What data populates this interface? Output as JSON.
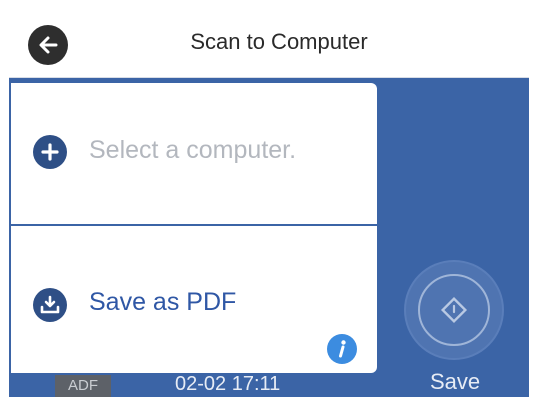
{
  "header": {
    "title": "Scan to Computer",
    "back_icon": "arrow-left-icon"
  },
  "options": [
    {
      "label": "Select a computer.",
      "icon": "plus-circle-icon",
      "state": "placeholder"
    },
    {
      "label": "Save as PDF",
      "icon": "download-tray-icon",
      "state": "selected"
    }
  ],
  "info_icon": "info-icon",
  "start_button": {
    "label": "Save",
    "icon": "diamond-start-icon"
  },
  "status_bar": {
    "source": "ADF",
    "datetime": "02-02 17:11"
  },
  "colors": {
    "screen_background": "#3b64a6",
    "accent_text": "#2f57a5",
    "placeholder_text": "#b3b7be",
    "info_blue": "#3c8ce0"
  }
}
